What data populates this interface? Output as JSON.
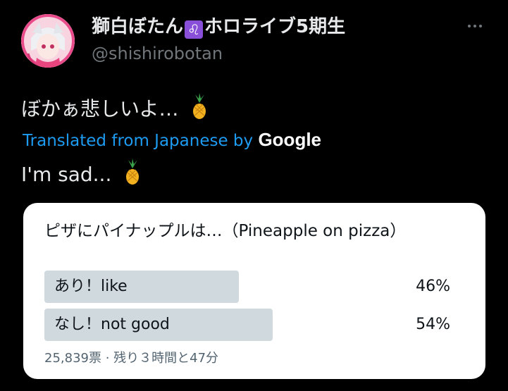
{
  "author": {
    "display_name_text": "獅白ぼたん",
    "zodiac_glyph": "♌",
    "display_name_suffix": "ホロライブ5期生",
    "handle": "@shishirobotan"
  },
  "tweet": {
    "text": "ぼかぁ悲しいよ…",
    "translated_by_label": "Translated from Japanese by",
    "translator_brand": "Google",
    "translation": "I'm sad..."
  },
  "poll": {
    "question": "ピザにパイナップルは…（Pineapple on pizza）",
    "options": [
      {
        "label": "あり！like",
        "percent_text": "46%",
        "fraction": 0.46
      },
      {
        "label": "なし！not good",
        "percent_text": "54%",
        "fraction": 0.54
      }
    ],
    "meta": "25,839票 · 残り３時間と47分"
  },
  "colors": {
    "background": "#000000",
    "link": "#1d9bf0",
    "poll_bar": "#cfd9de",
    "muted": "#71767b"
  },
  "icons": {
    "pineapple": "pineapple-icon",
    "more": "more-icon"
  }
}
